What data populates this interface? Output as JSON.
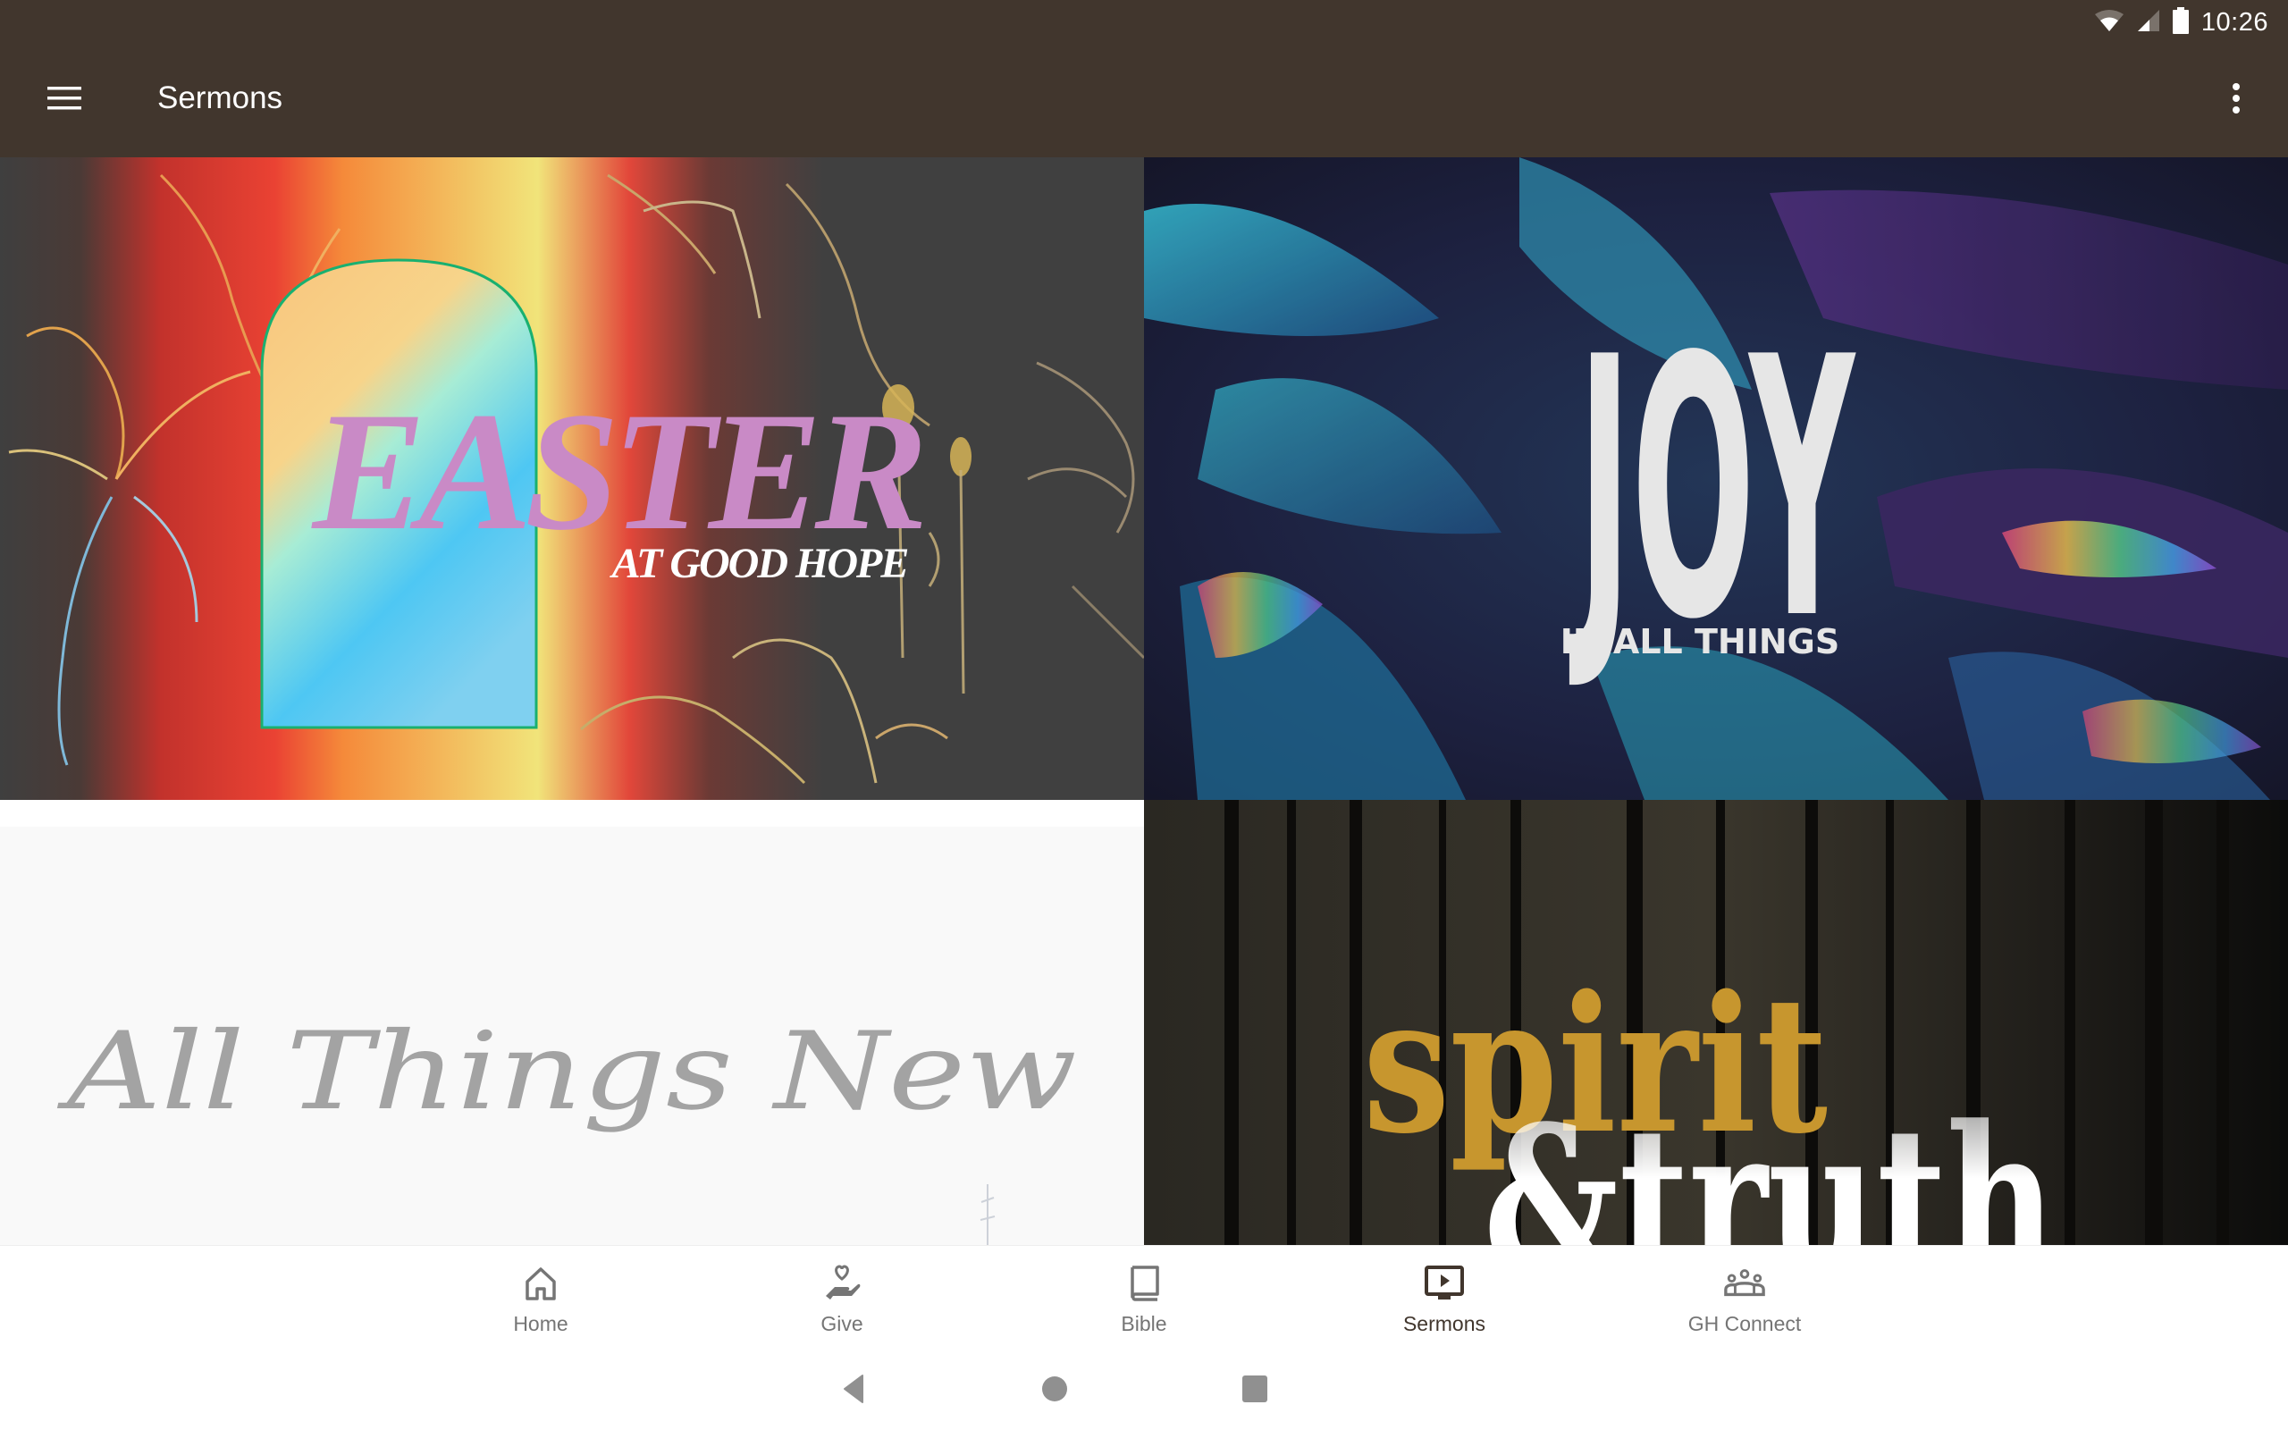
{
  "status_bar": {
    "time": "10:26",
    "icons": [
      "wifi-icon",
      "cell-signal-icon",
      "battery-icon"
    ]
  },
  "app_bar": {
    "title": "Sermons",
    "menu_icon": "hamburger-menu-icon",
    "overflow_icon": "more-vert-icon"
  },
  "sermon_series": [
    {
      "title": "EASTER",
      "subtitle": "AT GOOD HOPE",
      "theme": "rainbow-arch",
      "title_color": "#c98ac6"
    },
    {
      "title": "JOY",
      "subtitle": "IN ALL THINGS",
      "theme": "iridescent-leaves",
      "title_color": "#e6e6e6"
    },
    {
      "title": "All Things New",
      "subtitle": "",
      "theme": "script-on-white",
      "title_color": "#a3a3a3"
    },
    {
      "title": "spirit",
      "subtitle": "&truth",
      "theme": "dark-forest",
      "title_color": "#c7962e"
    }
  ],
  "bottom_nav": {
    "items": [
      {
        "label": "Home",
        "icon": "home-icon",
        "active": false
      },
      {
        "label": "Give",
        "icon": "give-hand-heart-icon",
        "active": false
      },
      {
        "label": "Bible",
        "icon": "book-icon",
        "active": false
      },
      {
        "label": "Sermons",
        "icon": "video-play-icon",
        "active": true
      },
      {
        "label": "GH Connect",
        "icon": "groups-icon",
        "active": false
      }
    ],
    "active_color": "#41362d",
    "inactive_color": "#757575"
  },
  "system_nav": {
    "back": "back-icon",
    "home": "home-circle-icon",
    "recents": "recents-icon"
  },
  "colors": {
    "app_bar": "#41362d",
    "background": "#ffffff"
  }
}
